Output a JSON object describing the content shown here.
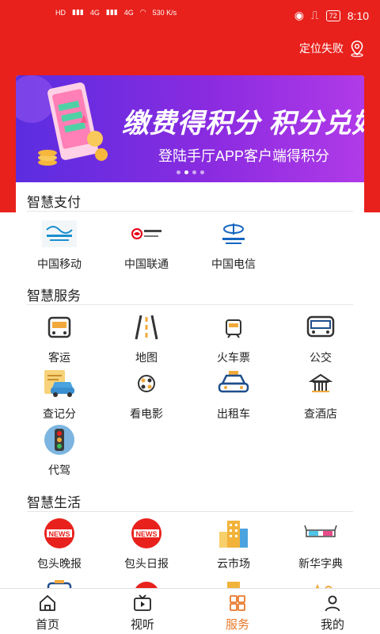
{
  "status_bar": {
    "left_labels": [
      "HD",
      "4G",
      "4G",
      "530 K/s"
    ],
    "battery": "72",
    "time": "8:10"
  },
  "header": {
    "location_text": "定位失败"
  },
  "banner": {
    "title": "缴费得积分 积分兑好礼",
    "subtitle": "登陆手厅APP客户端得积分",
    "slide_index": 2,
    "slide_count": 4
  },
  "sections": {
    "payment": {
      "title": "智慧支付",
      "items": [
        {
          "label": "中国移动",
          "icon": "china-mobile-logo"
        },
        {
          "label": "中国联通",
          "icon": "china-unicom-logo"
        },
        {
          "label": "中国电信",
          "icon": "china-telecom-logo"
        }
      ]
    },
    "services": {
      "title": "智慧服务",
      "items": [
        {
          "label": "客运",
          "icon": "bus-front-icon"
        },
        {
          "label": "地图",
          "icon": "road-icon"
        },
        {
          "label": "火车票",
          "icon": "train-icon"
        },
        {
          "label": "公交",
          "icon": "city-bus-icon"
        },
        {
          "label": "查记分",
          "icon": "car-check-icon"
        },
        {
          "label": "看电影",
          "icon": "film-reel-icon"
        },
        {
          "label": "出租车",
          "icon": "taxi-icon"
        },
        {
          "label": "查酒店",
          "icon": "hotel-icon"
        },
        {
          "label": "代驾",
          "icon": "traffic-light-icon"
        }
      ]
    },
    "life": {
      "title": "智慧生活",
      "items": [
        {
          "label": "包头晚报",
          "icon": "news-icon"
        },
        {
          "label": "包头日报",
          "icon": "news-icon"
        },
        {
          "label": "云市场",
          "icon": "buildings-icon"
        },
        {
          "label": "新华字典",
          "icon": "3d-glasses-icon"
        }
      ]
    }
  },
  "tabbar": {
    "items": [
      {
        "label": "首页",
        "icon": "home-icon"
      },
      {
        "label": "视听",
        "icon": "tv-icon"
      },
      {
        "label": "服务",
        "icon": "grid-icon",
        "active": true
      },
      {
        "label": "我的",
        "icon": "user-icon"
      }
    ]
  },
  "colors": {
    "brand_red": "#e8211c",
    "active_tab": "#e8782a",
    "banner_purple": "#7a2be0"
  }
}
